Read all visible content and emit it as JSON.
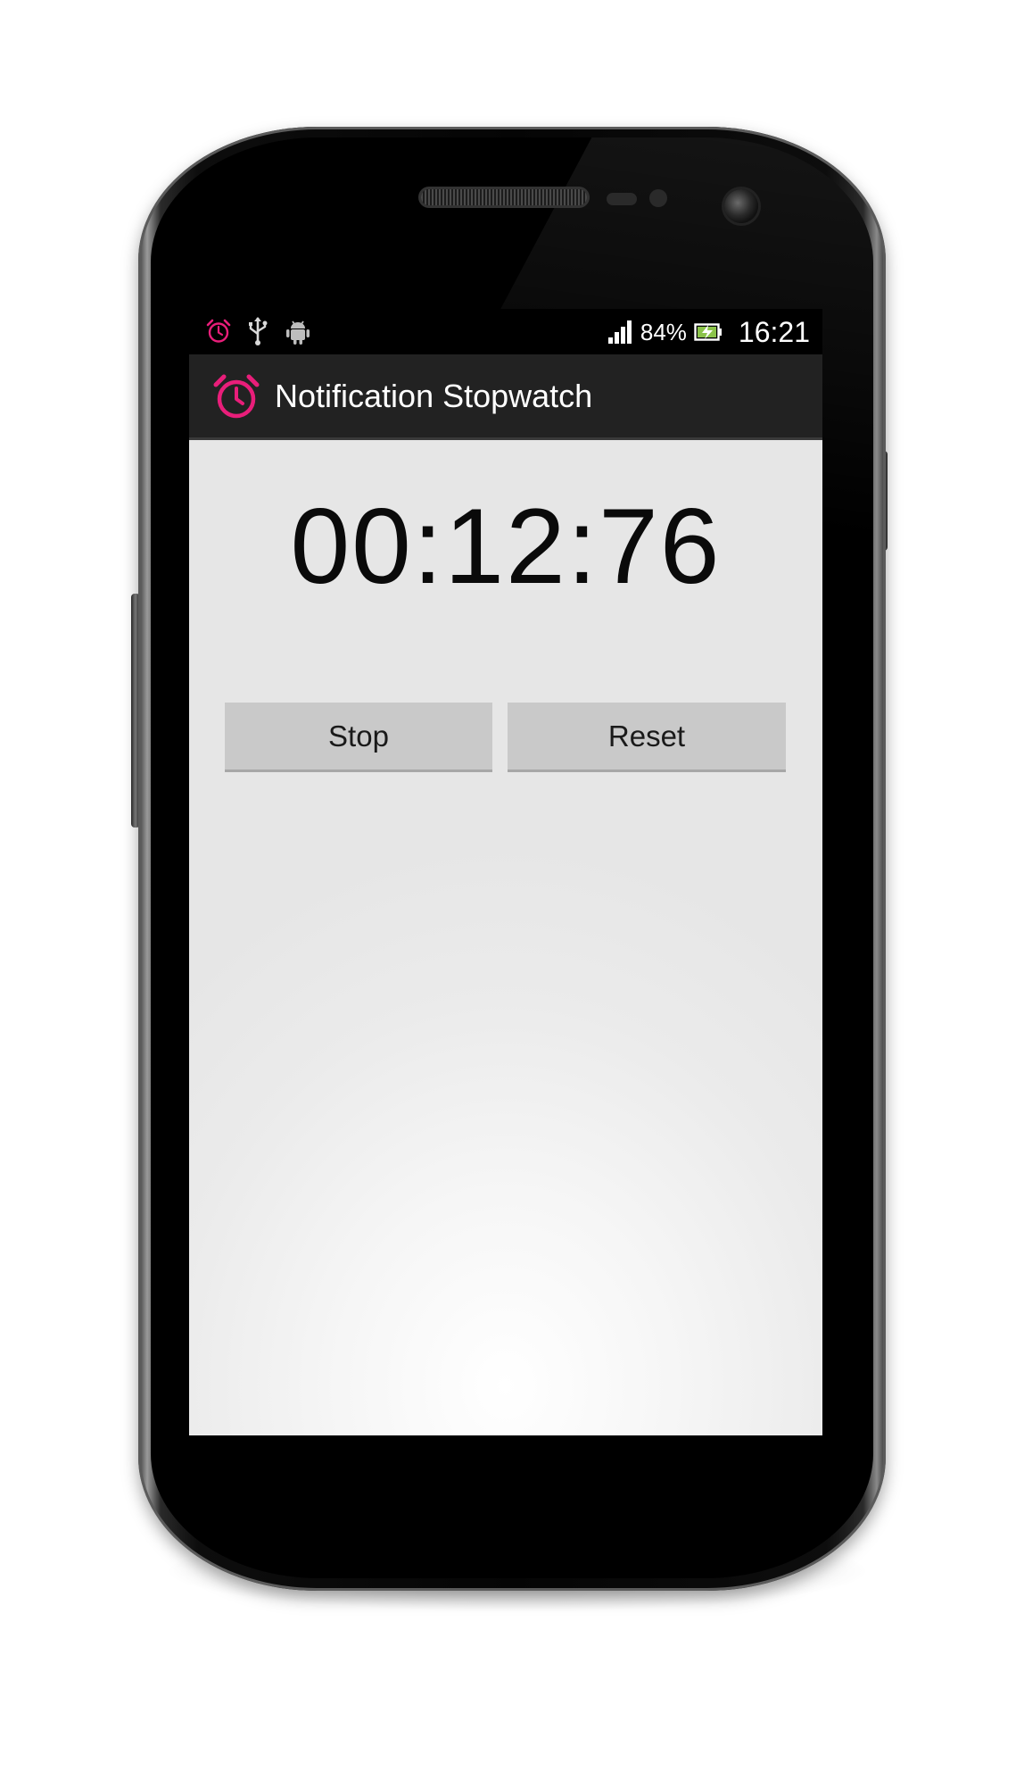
{
  "status_bar": {
    "icons_left": [
      "alarm-icon",
      "usb-icon",
      "android-icon"
    ],
    "battery_percent": "84%",
    "time": "16:21",
    "alarm_color": "#e91e7a"
  },
  "action_bar": {
    "title": "Notification Stopwatch",
    "icon": "alarm-clock-icon",
    "icon_color": "#e91e7a"
  },
  "stopwatch": {
    "time_display": "00:12:76"
  },
  "buttons": {
    "stop_label": "Stop",
    "reset_label": "Reset"
  }
}
